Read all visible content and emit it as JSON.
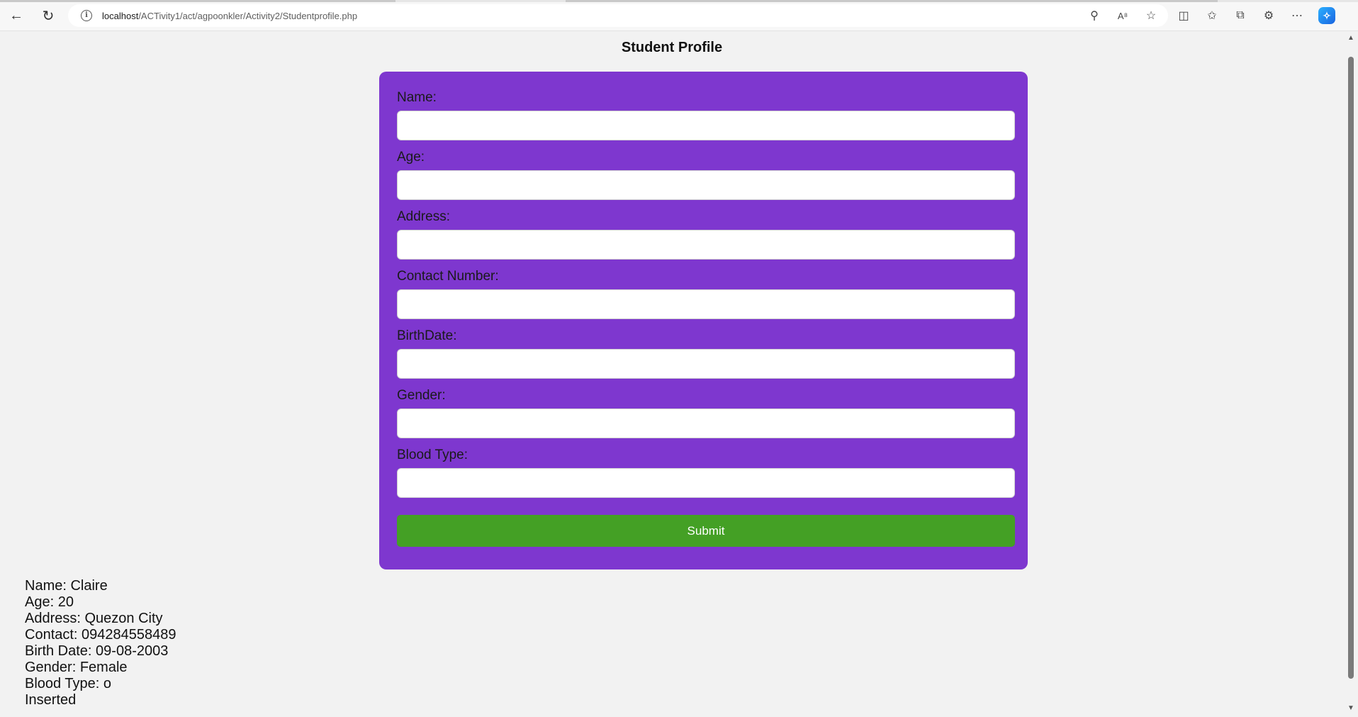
{
  "browser": {
    "url_host": "localhost",
    "url_path": "/ACTivity1/act/agpoonkler/Activity2/Studentprofile.php",
    "icons": [
      "back-icon",
      "refresh-icon",
      "info-icon",
      "zoom-icon",
      "read-aloud-icon",
      "favorite-icon",
      "split-screen-icon",
      "favorites-icon",
      "collections-icon",
      "extensions-icon",
      "more-icon",
      "copilot-icon"
    ]
  },
  "page": {
    "title": "Student Profile"
  },
  "form": {
    "fields": [
      {
        "label": "Name:",
        "value": ""
      },
      {
        "label": "Age:",
        "value": ""
      },
      {
        "label": "Address:",
        "value": ""
      },
      {
        "label": "Contact Number:",
        "value": ""
      },
      {
        "label": "BirthDate:",
        "value": ""
      },
      {
        "label": "Gender:",
        "value": ""
      },
      {
        "label": "Blood Type:",
        "value": ""
      }
    ],
    "submit_label": "Submit"
  },
  "output": {
    "lines": [
      "Name: Claire",
      "Age: 20",
      "Address: Quezon City",
      "Contact: 094284558489",
      "Birth Date: 09-08-2003",
      "Gender: Female",
      "Blood Type: o",
      "Inserted"
    ]
  },
  "colors": {
    "card": "#7e37cf",
    "submit": "#44a025",
    "page_bg": "#f2f2f2"
  }
}
